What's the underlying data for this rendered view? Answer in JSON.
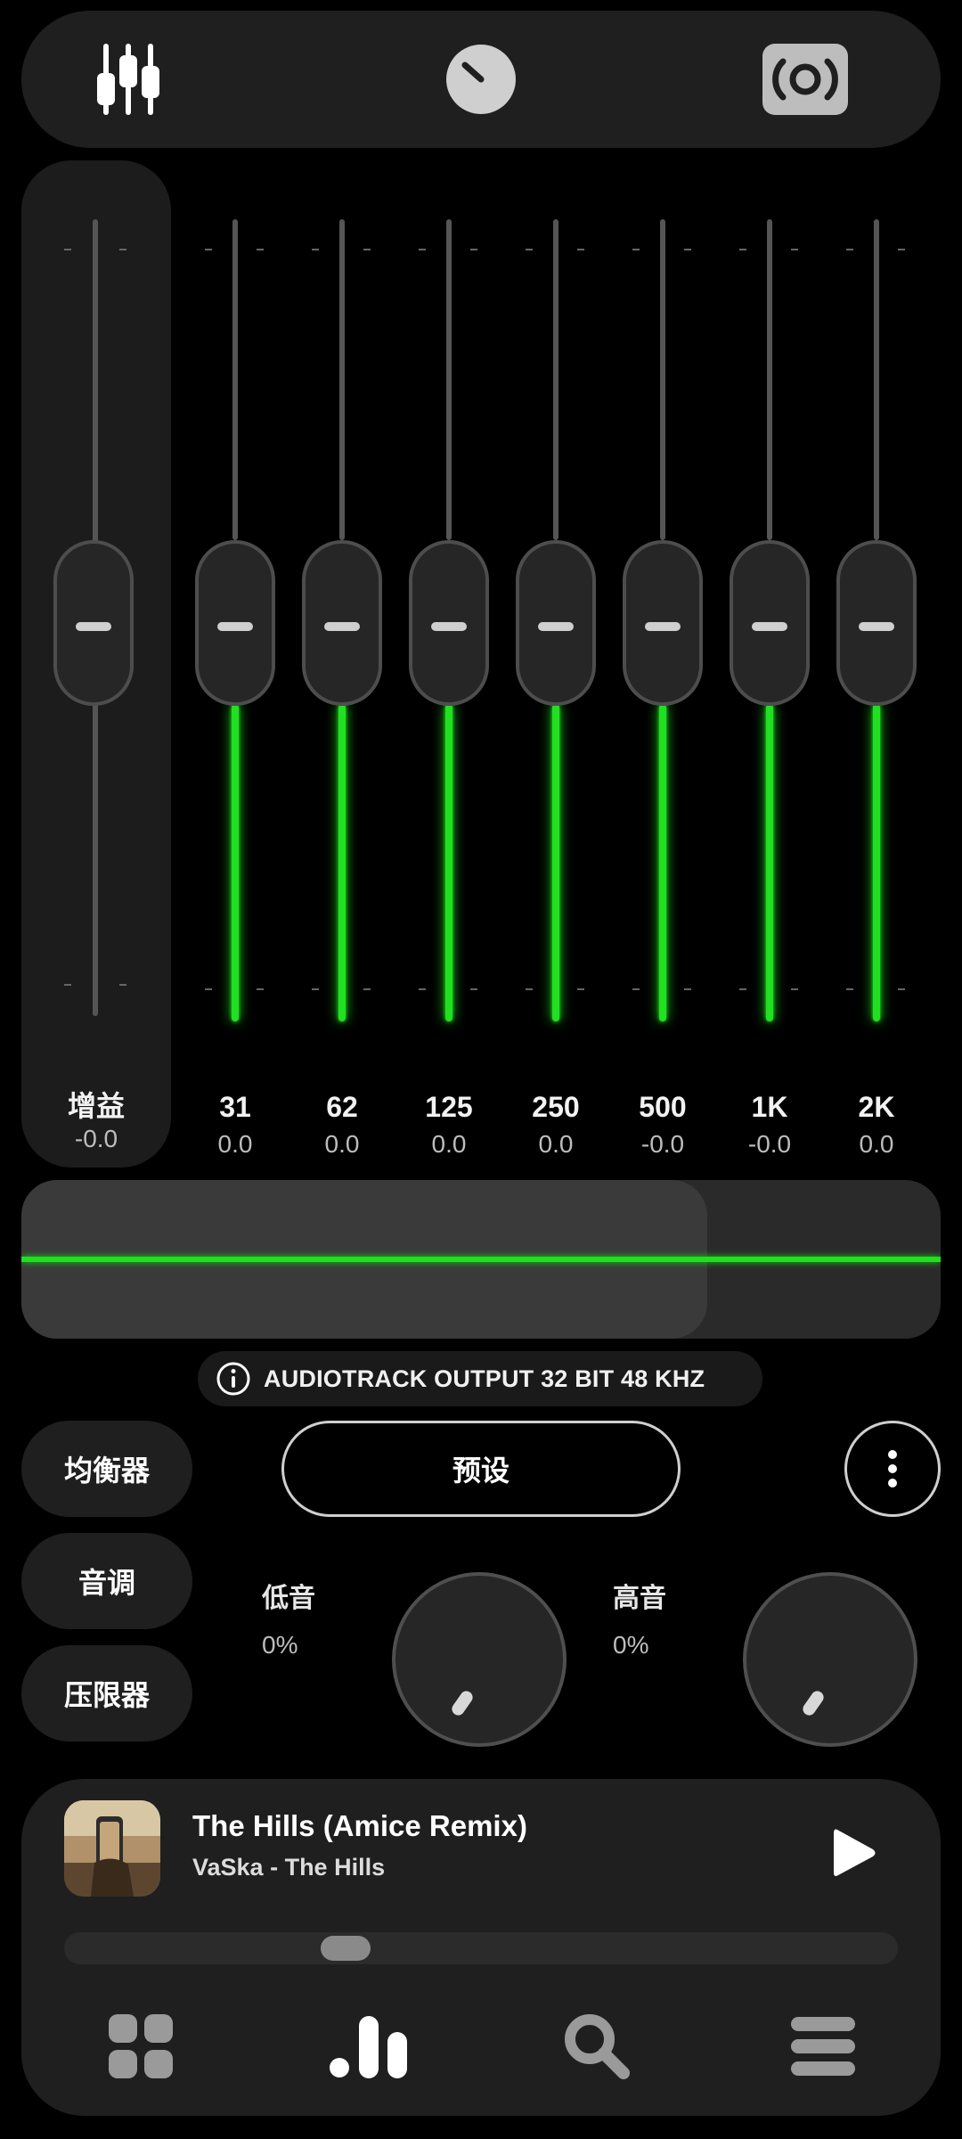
{
  "top_tabs": [
    {
      "icon": "sliders-icon"
    },
    {
      "icon": "knob-icon"
    },
    {
      "icon": "speaker-icon"
    }
  ],
  "gain": {
    "label": "增益",
    "value": "-0.0"
  },
  "bands": [
    {
      "freq": "31",
      "value": "0.0"
    },
    {
      "freq": "62",
      "value": "0.0"
    },
    {
      "freq": "125",
      "value": "0.0"
    },
    {
      "freq": "250",
      "value": "0.0"
    },
    {
      "freq": "500",
      "value": "-0.0"
    },
    {
      "freq": "1K",
      "value": "-0.0"
    },
    {
      "freq": "2K",
      "value": "0.0"
    }
  ],
  "output_info": "AUDIOTRACK OUTPUT  32 BIT  48 KHZ",
  "modes": {
    "equalizer": "均衡器",
    "tone": "音调",
    "limiter": "压限器"
  },
  "preset_label": "预设",
  "bass": {
    "label": "低音",
    "value": "0%"
  },
  "treble": {
    "label": "高音",
    "value": "0%"
  },
  "player": {
    "title": "The Hills (Amice Remix)",
    "artist": "VaSka - The Hills",
    "progress_fraction": 0.25
  },
  "bottom_nav": [
    {
      "icon": "grid-icon"
    },
    {
      "icon": "bars-icon"
    },
    {
      "icon": "search-icon"
    },
    {
      "icon": "menu-icon"
    }
  ],
  "colors": {
    "accent": "#21e021",
    "panel": "#1f1f1f",
    "background": "#000000"
  }
}
